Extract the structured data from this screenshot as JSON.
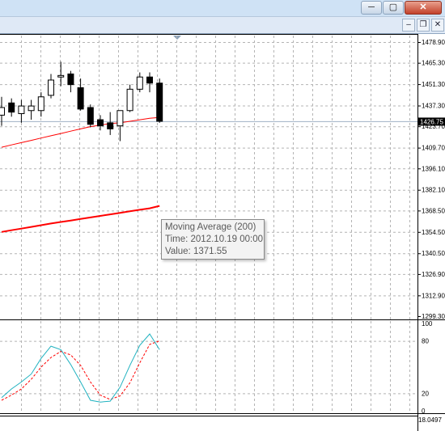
{
  "window": {
    "minimize_label": "─",
    "maximize_label": "▢",
    "close_label": "✕",
    "mdi_minimize_label": "–",
    "mdi_restore_label": "❐",
    "mdi_close_label": "✕"
  },
  "price_axis": {
    "ticks": [
      "1478.90",
      "1465.30",
      "1451.30",
      "1437.30",
      "1423.70",
      "1409.70",
      "1396.10",
      "1382.10",
      "1368.50",
      "1354.50",
      "1340.50",
      "1326.90",
      "1312.90",
      "1299.30"
    ],
    "current_price": "1426.75",
    "current_price_value": 1426.75
  },
  "oscillator_axis": {
    "ticks": [
      "100",
      "80",
      "20",
      "0"
    ]
  },
  "bottom_axis": {
    "value": "18.0497"
  },
  "tooltip": {
    "title": "Moving Average (200)",
    "time": "Time: 2012.10.19 00:00",
    "value": "Value: 1371.55"
  },
  "colors": {
    "grid": "#b4b4b4",
    "ma_line": "#ff0000",
    "stoch_main": "#20b2c0",
    "stoch_signal": "#ff0000",
    "candle": "#000000",
    "price_line": "#9fb0c4"
  },
  "chart_data": {
    "type": "candlestick",
    "price_range": [
      1299.3,
      1485.0
    ],
    "candles": [
      {
        "o": 1431,
        "h": 1443,
        "l": 1424,
        "c": 1436
      },
      {
        "o": 1439,
        "h": 1442,
        "l": 1430,
        "c": 1433
      },
      {
        "o": 1432,
        "h": 1441,
        "l": 1426,
        "c": 1437
      },
      {
        "o": 1434,
        "h": 1441,
        "l": 1428,
        "c": 1437
      },
      {
        "o": 1434,
        "h": 1446,
        "l": 1430,
        "c": 1443
      },
      {
        "o": 1444,
        "h": 1458,
        "l": 1442,
        "c": 1454
      },
      {
        "o": 1456,
        "h": 1466,
        "l": 1450,
        "c": 1457
      },
      {
        "o": 1458,
        "h": 1460,
        "l": 1446,
        "c": 1451
      },
      {
        "o": 1449,
        "h": 1455,
        "l": 1434,
        "c": 1435
      },
      {
        "o": 1436,
        "h": 1438,
        "l": 1423,
        "c": 1425
      },
      {
        "o": 1428,
        "h": 1431,
        "l": 1421,
        "c": 1424
      },
      {
        "o": 1426,
        "h": 1433,
        "l": 1418,
        "c": 1422
      },
      {
        "o": 1424,
        "h": 1434,
        "l": 1414,
        "c": 1434
      },
      {
        "o": 1434,
        "h": 1451,
        "l": 1433,
        "c": 1448
      },
      {
        "o": 1448,
        "h": 1459,
        "l": 1446,
        "c": 1456
      },
      {
        "o": 1456,
        "h": 1459,
        "l": 1446,
        "c": 1452
      },
      {
        "o": 1452,
        "h": 1455,
        "l": 1426,
        "c": 1427
      }
    ],
    "ma_fast": [
      1410,
      1411.5,
      1413,
      1414.5,
      1416,
      1417.5,
      1419,
      1420.5,
      1422,
      1423.5,
      1424.5,
      1425.5,
      1426,
      1427,
      1428,
      1429,
      1429.5
    ],
    "ma_200": [
      1354.5,
      1355.6,
      1356.7,
      1357.8,
      1358.9,
      1360,
      1361,
      1362,
      1363,
      1364,
      1365,
      1366,
      1367,
      1368,
      1369,
      1370,
      1371.55
    ],
    "stochastic": {
      "range": [
        0,
        100
      ],
      "levels": [
        20,
        80
      ],
      "main": [
        15,
        25,
        33,
        42,
        60,
        74,
        70,
        53,
        33,
        12,
        10,
        11,
        27,
        52,
        75,
        88,
        70
      ],
      "signal": [
        12,
        18,
        25,
        36,
        50,
        61,
        68,
        64,
        52,
        33,
        18,
        13,
        17,
        32,
        55,
        76,
        80
      ]
    }
  }
}
